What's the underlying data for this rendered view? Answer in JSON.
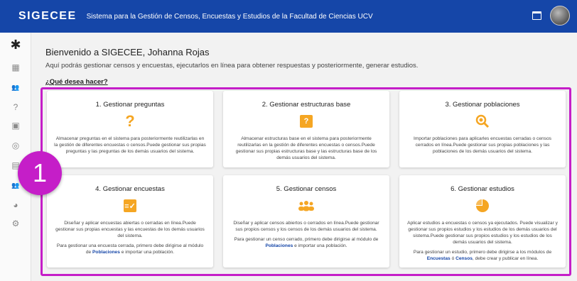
{
  "header": {
    "logo": "SIGECEE",
    "title": "Sistema para la Gestión de Censos, Encuestas y Estudios de la Facultad de Ciencias UCV"
  },
  "sidebar": {
    "items": [
      {
        "icon": "dashboard-icon",
        "glyph": "▦"
      },
      {
        "icon": "users-icon",
        "glyph": "👥"
      },
      {
        "icon": "question-icon",
        "glyph": "?"
      },
      {
        "icon": "structure-icon",
        "glyph": "▣"
      },
      {
        "icon": "population-search-icon",
        "glyph": "◎"
      },
      {
        "icon": "survey-icon",
        "glyph": "▤"
      },
      {
        "icon": "census-icon",
        "glyph": "👥"
      },
      {
        "icon": "studies-pie-icon",
        "glyph": "◕"
      },
      {
        "icon": "settings-icon",
        "glyph": "⚙"
      }
    ]
  },
  "main": {
    "greeting": "Bienvenido a SIGECEE, Johanna Rojas",
    "intro": "Aquí podrás gestionar censos y encuestas, ejecutarlos en línea para obtener respuestas y posteriormente, generar estudios.",
    "question": "¿Qué desea hacer?"
  },
  "cards": [
    {
      "title": "1. Gestionar preguntas",
      "icon": "question-mark-icon",
      "desc": "Almacenar preguntas en el sistema para posteriormente reutilizarlas en la gestión de diferentes encuestas o censos.Puede gestionar sus propias preguntas y las preguntas de los demás usuarios del sistema."
    },
    {
      "title": "2. Gestionar estructuras base",
      "icon": "structure-base-icon",
      "desc": "Almacenar estructuras base en el sistema para posteriormente reutilizarlas en la gestión de diferentes encuestas o censos.Puede gestionar sus propias estructuras base y las estructuras base de los demás usuarios del sistema."
    },
    {
      "title": "3. Gestionar poblaciones",
      "icon": "population-search-icon",
      "desc": "Importar poblaciones para aplicarles encuestas cerradas o censos cerrados en línea.Puede gestionar sus propias poblaciones y las poblaciones de los demás usuarios del sistema."
    },
    {
      "title": "4. Gestionar encuestas",
      "icon": "survey-checklist-icon",
      "desc": "Diseñar y aplicar encuestas abiertas o cerradas en línea.Puede gestionar sus propias encuestas y las encuestas de los demás usuarios del sistema.",
      "note_pre": "Para gestionar una encuesta cerrada, primero debe dirigirse al módulo de",
      "note_link": "Poblaciones",
      "note_post": "e importar una población."
    },
    {
      "title": "5. Gestionar censos",
      "icon": "census-people-icon",
      "desc": "Diseñar y aplicar censos abiertos o cerrados en línea.Puede gestionar sus propios censos y los censos de los demás usuarios del sistema.",
      "note_pre": "Para gestionar un censo cerrado, primero debe dirigirse al módulo de",
      "note_link": "Poblaciones",
      "note_post": "e importar una población."
    },
    {
      "title": "6. Gestionar estudios",
      "icon": "studies-pie-icon",
      "desc": "Aplicar estudios a encuestas o censos ya ejecutados. Puede visualizar y gestionar sus propios estudios y los estudios de los demás usuarios del sistema.Puede gestionar sus propios estudios y los estudios de los demás usuarios del sistema.",
      "note_pre": "Para gestionar un estudio, primero debe dirigirse a los módulos de",
      "note_link": "Encuestas",
      "note_mid": "ó",
      "note_link2": "Censos",
      "note_post": ", debe crear y publicar en línea."
    }
  ],
  "annotation": {
    "badge": "1",
    "accent_color": "#c51ec8"
  },
  "colors": {
    "header_bg": "#1546a8",
    "icon_accent": "#f5a623"
  }
}
